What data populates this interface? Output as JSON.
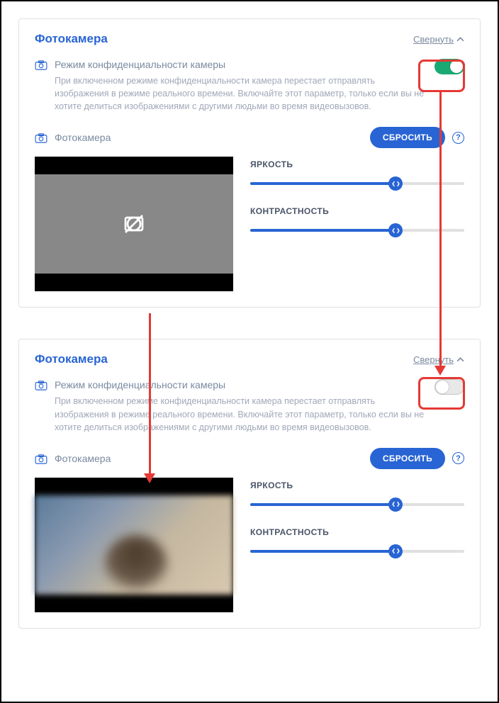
{
  "panel_top": {
    "title": "Фотокамера",
    "collapse": "Свернуть",
    "privacy_title": "Режим конфиденциальности камеры",
    "privacy_desc": "При включенном режиме конфиденциальности камера перестает отправлять изображения в режиме реального времени. Включайте этот параметр, только если вы не хотите делиться изображениями с другими людьми во время видеовызовов.",
    "toggle_on": true,
    "camera_section_title": "Фотокамера",
    "reset": "СБРОСИТЬ",
    "brightness_label": "ЯРКОСТЬ",
    "contrast_label": "КОНТРАСТНОСТЬ",
    "brightness_value": 68,
    "contrast_value": 68
  },
  "panel_bottom": {
    "title": "Фотокамера",
    "collapse": "Свернуть",
    "privacy_title": "Режим конфиденциальности камеры",
    "privacy_desc": "При включенном режиме конфиденциальности камера перестает отправлять изображения в режиме реального времени. Включайте этот параметр, только если вы не хотите делиться изображениями с другими людьми во время видеовызовов.",
    "toggle_on": false,
    "camera_section_title": "Фотокамера",
    "reset": "СБРОСИТЬ",
    "brightness_label": "ЯРКОСТЬ",
    "contrast_label": "КОНТРАСТНОСТЬ",
    "brightness_value": 68,
    "contrast_value": 68
  },
  "help_char": "?"
}
